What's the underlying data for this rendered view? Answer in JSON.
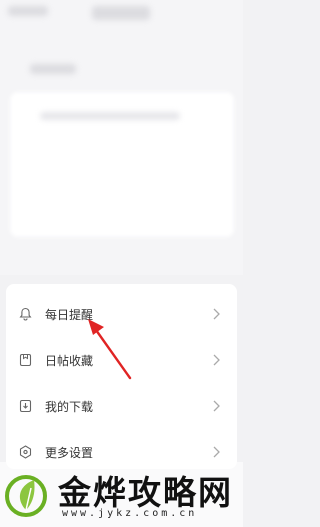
{
  "menu": {
    "items": [
      {
        "label": "每日提醒",
        "icon": "bell-icon"
      },
      {
        "label": "日帖收藏",
        "icon": "bookmark-icon"
      },
      {
        "label": "我的下载",
        "icon": "download-icon"
      },
      {
        "label": "更多设置",
        "icon": "settings-icon"
      }
    ]
  },
  "annotation": {
    "arrow_color": "#e02424"
  },
  "watermark": {
    "title": "金烨攻略网",
    "url": "www.jykz.com.cn",
    "logo_color": "#6ab023"
  }
}
